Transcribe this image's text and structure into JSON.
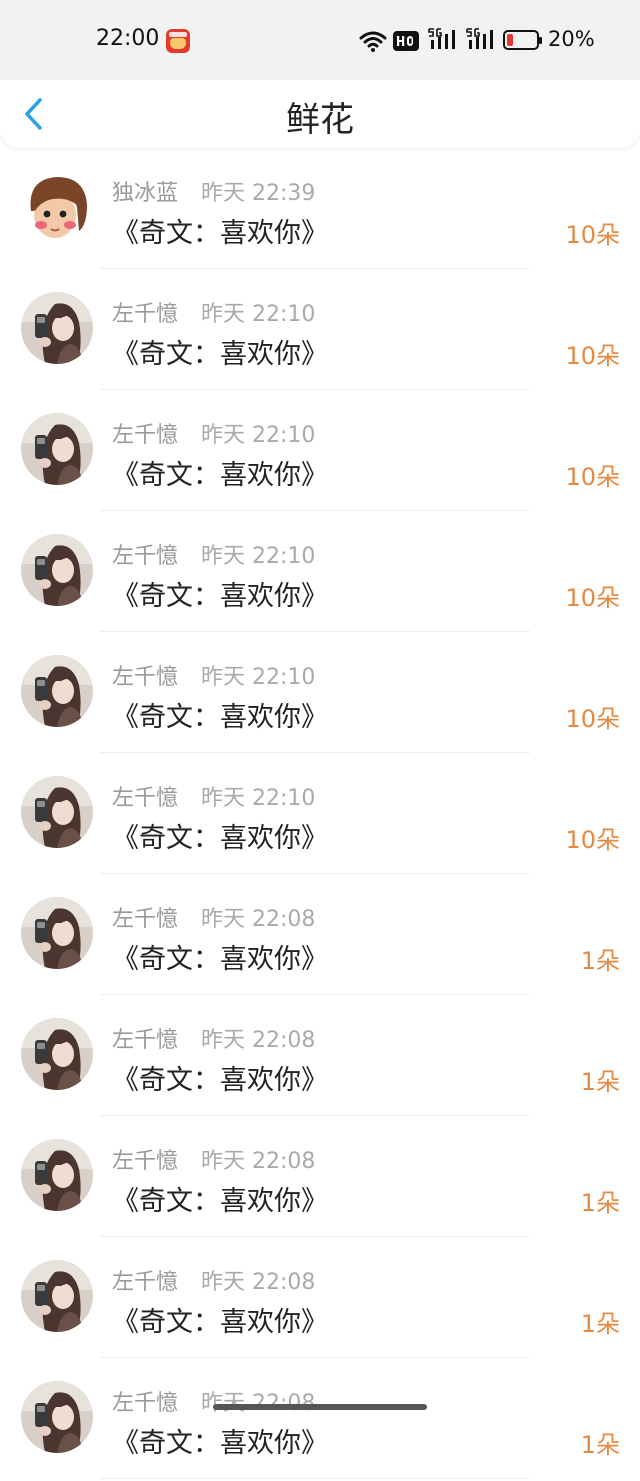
{
  "status_bar": {
    "time": "22:00",
    "app_icon": "takeout-app-icon",
    "icons": [
      "wifi-icon",
      "hd-icon",
      "5g-signal-icon",
      "5g-signal-icon"
    ],
    "battery_text": "20%",
    "battery_level": 0.2
  },
  "header": {
    "back_icon": "chevron-left-icon",
    "title": "鲜花"
  },
  "colors": {
    "accent": "#29a3e6",
    "count": "#e58a43",
    "battery_low": "#e53935"
  },
  "records": [
    {
      "name": "独冰蓝",
      "time": "昨天 22:39",
      "message": "《奇文：喜欢你》",
      "count": "10朵",
      "avatar": "cartoon-girl-avatar"
    },
    {
      "name": "左千憶",
      "time": "昨天 22:10",
      "message": "《奇文：喜欢你》",
      "count": "10朵",
      "avatar": "selfie-avatar"
    },
    {
      "name": "左千憶",
      "time": "昨天 22:10",
      "message": "《奇文：喜欢你》",
      "count": "10朵",
      "avatar": "selfie-avatar"
    },
    {
      "name": "左千憶",
      "time": "昨天 22:10",
      "message": "《奇文：喜欢你》",
      "count": "10朵",
      "avatar": "selfie-avatar"
    },
    {
      "name": "左千憶",
      "time": "昨天 22:10",
      "message": "《奇文：喜欢你》",
      "count": "10朵",
      "avatar": "selfie-avatar"
    },
    {
      "name": "左千憶",
      "time": "昨天 22:10",
      "message": "《奇文：喜欢你》",
      "count": "10朵",
      "avatar": "selfie-avatar"
    },
    {
      "name": "左千憶",
      "time": "昨天 22:08",
      "message": "《奇文：喜欢你》",
      "count": "1朵",
      "avatar": "selfie-avatar"
    },
    {
      "name": "左千憶",
      "time": "昨天 22:08",
      "message": "《奇文：喜欢你》",
      "count": "1朵",
      "avatar": "selfie-avatar"
    },
    {
      "name": "左千憶",
      "time": "昨天 22:08",
      "message": "《奇文：喜欢你》",
      "count": "1朵",
      "avatar": "selfie-avatar"
    },
    {
      "name": "左千憶",
      "time": "昨天 22:08",
      "message": "《奇文：喜欢你》",
      "count": "1朵",
      "avatar": "selfie-avatar"
    },
    {
      "name": "左千憶",
      "time": "昨天 22:08",
      "message": "《奇文：喜欢你》",
      "count": "1朵",
      "avatar": "selfie-avatar"
    }
  ]
}
